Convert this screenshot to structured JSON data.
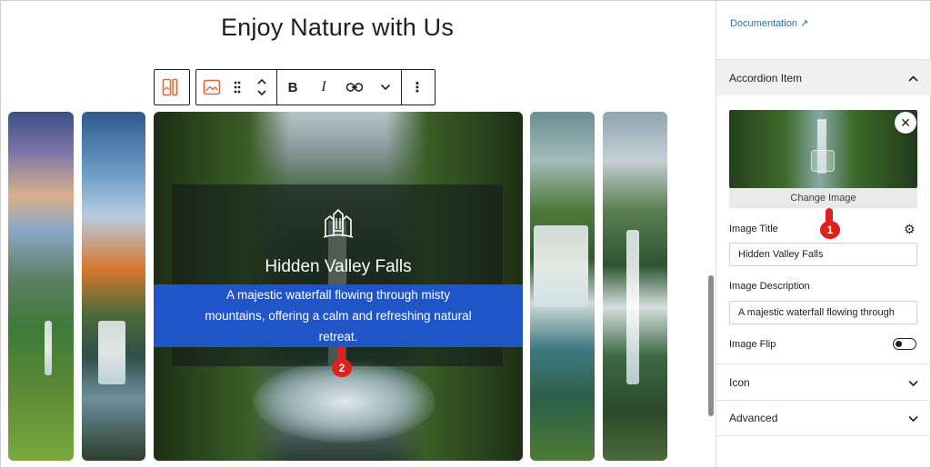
{
  "page": {
    "title": "Enjoy Nature with Us"
  },
  "block_toolbar": {
    "buttons": [
      "block-type-icon",
      "image-icon",
      "drag-handle-icon",
      "move-up-down-icon",
      "bold-icon",
      "italic-icon",
      "link-icon",
      "more-chevron-icon",
      "options-icon"
    ],
    "bold_label": "B",
    "italic_label": "I",
    "options_label": "⋮"
  },
  "accordion": {
    "active_item": {
      "title": "Hidden Valley Falls",
      "description_lines": [
        "A majestic waterfall flowing through misty",
        "mountains, offering a calm and refreshing natural",
        "retreat."
      ]
    }
  },
  "annotations": {
    "step1": "1",
    "step2": "2"
  },
  "sidebar": {
    "documentation_link": "Documentation ↗",
    "section_accordion_item": "Accordion Item",
    "change_image_label": "Change Image",
    "image_title_label": "Image Title",
    "image_title_value": "Hidden Valley Falls",
    "image_description_label": "Image Description",
    "image_description_value": "A majestic waterfall flowing through",
    "image_flip_label": "Image Flip",
    "image_flip_on": false,
    "section_icon": "Icon",
    "section_advanced": "Advanced",
    "close_label": "✕"
  },
  "colors": {
    "accent_orange": "#e8662e",
    "link_blue": "#2271b1",
    "selection_blue": "#1f55c7",
    "annotation_red": "#e0201b"
  }
}
